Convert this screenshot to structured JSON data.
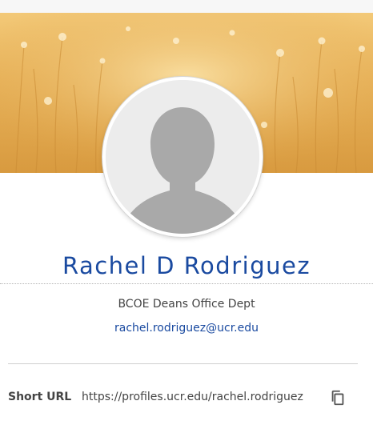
{
  "profile": {
    "name": "Rachel D Rodriguez",
    "department": "BCOE Deans Office Dept",
    "email": "rachel.rodriguez@ucr.edu"
  },
  "short_url": {
    "label": "Short URL",
    "value": "https://profiles.ucr.edu/rachel.rodriguez"
  },
  "icons": {
    "copy": "copy-icon",
    "avatar": "person-silhouette-icon"
  },
  "colors": {
    "name_link": "#1a4aa0",
    "banner": "#e8b35b",
    "text": "#444444"
  }
}
